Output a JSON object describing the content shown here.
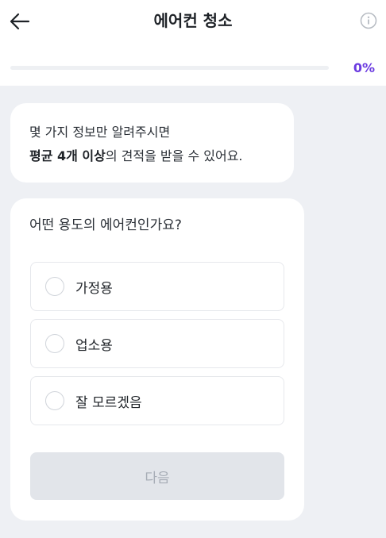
{
  "header": {
    "title": "에어컨 청소",
    "back_icon": "arrow-left-icon",
    "info_icon": "info-circle-icon"
  },
  "progress": {
    "value": 0,
    "label": "0%",
    "accent_color": "#6b3be0"
  },
  "intro": {
    "line1": "몇 가지 정보만 알려주시면",
    "line2_bold": "평균 4개 이상",
    "line2_rest": "의 견적을 받을 수 있어요."
  },
  "question": {
    "text": "어떤 용도의 에어컨인가요?",
    "options": [
      {
        "label": "가정용"
      },
      {
        "label": "업소용"
      },
      {
        "label": "잘 모르겠음"
      }
    ]
  },
  "next_button": {
    "label": "다음",
    "disabled": true
  }
}
